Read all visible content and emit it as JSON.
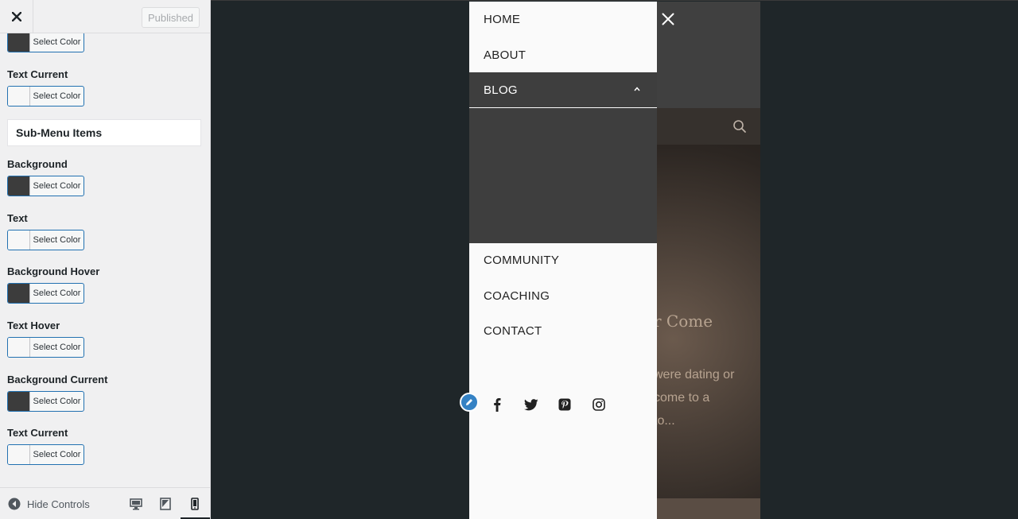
{
  "header": {
    "published_label": "Published"
  },
  "controls": {
    "select_color_label": "Select Color",
    "section_title": "Sub-Menu Items",
    "items": [
      {
        "label": "",
        "swatch": "#3c3c3c"
      },
      {
        "label": "Text Current",
        "swatch": "#f7f7f7"
      },
      {
        "label": "Background",
        "swatch": "#3c3c3c"
      },
      {
        "label": "Text",
        "swatch": "#f7f7f7"
      },
      {
        "label": "Background Hover",
        "swatch": "#3c3c3c"
      },
      {
        "label": "Text Hover",
        "swatch": "#f7f7f7"
      },
      {
        "label": "Background Current",
        "swatch": "#3c3c3c"
      },
      {
        "label": "Text Current",
        "swatch": "#f7f7f7"
      }
    ]
  },
  "footer": {
    "hide_controls_label": "Hide Controls",
    "active_device": "mobile"
  },
  "menu": {
    "items": [
      "HOME",
      "ABOUT",
      "BLOG",
      "COMMUNITY",
      "COACHING",
      "CONTACT"
    ],
    "expanded_item": "BLOG"
  },
  "hero": {
    "title_fragment": "r Come",
    "lines": [
      "were dating or",
      "come to a",
      "to..."
    ]
  },
  "colors": {
    "accent": "#2271b1",
    "menu_active_bg": "#3e3e3e",
    "preview_bg": "#1f2629"
  }
}
